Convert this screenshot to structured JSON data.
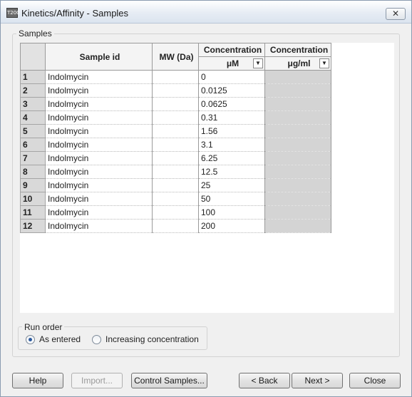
{
  "window": {
    "title": "Kinetics/Affinity - Samples",
    "app_icon_text": "T200",
    "close_glyph": "✕"
  },
  "samples_group": {
    "label": "Samples",
    "columns": {
      "sample_id": "Sample id",
      "mw": "MW (Da)",
      "conc1_header": "Concentration",
      "conc1_unit": "μM",
      "conc2_header": "Concentration",
      "conc2_unit": "μg/ml",
      "dropdown_glyph": "▼"
    },
    "rows": [
      {
        "num": "1",
        "sample_id": "Indolmycin",
        "mw": "",
        "conc": "0"
      },
      {
        "num": "2",
        "sample_id": "Indolmycin",
        "mw": "",
        "conc": "0.0125"
      },
      {
        "num": "3",
        "sample_id": "Indolmycin",
        "mw": "",
        "conc": "0.0625"
      },
      {
        "num": "4",
        "sample_id": "Indolmycin",
        "mw": "",
        "conc": "0.31"
      },
      {
        "num": "5",
        "sample_id": "Indolmycin",
        "mw": "",
        "conc": "1.56"
      },
      {
        "num": "6",
        "sample_id": "Indolmycin",
        "mw": "",
        "conc": "3.1"
      },
      {
        "num": "7",
        "sample_id": "Indolmycin",
        "mw": "",
        "conc": "6.25"
      },
      {
        "num": "8",
        "sample_id": "Indolmycin",
        "mw": "",
        "conc": "12.5"
      },
      {
        "num": "9",
        "sample_id": "Indolmycin",
        "mw": "",
        "conc": "25"
      },
      {
        "num": "10",
        "sample_id": "Indolmycin",
        "mw": "",
        "conc": "50"
      },
      {
        "num": "11",
        "sample_id": "Indolmycin",
        "mw": "",
        "conc": "100"
      },
      {
        "num": "12",
        "sample_id": "Indolmycin",
        "mw": "",
        "conc": "200"
      }
    ]
  },
  "run_order": {
    "label": "Run order",
    "options": [
      {
        "label": "As entered",
        "selected": true
      },
      {
        "label": "Increasing concentration",
        "selected": false
      }
    ]
  },
  "buttons": {
    "help": "Help",
    "import": "Import...",
    "control_samples": "Control Samples...",
    "back": "< Back",
    "next": "Next >",
    "close": "Close"
  }
}
